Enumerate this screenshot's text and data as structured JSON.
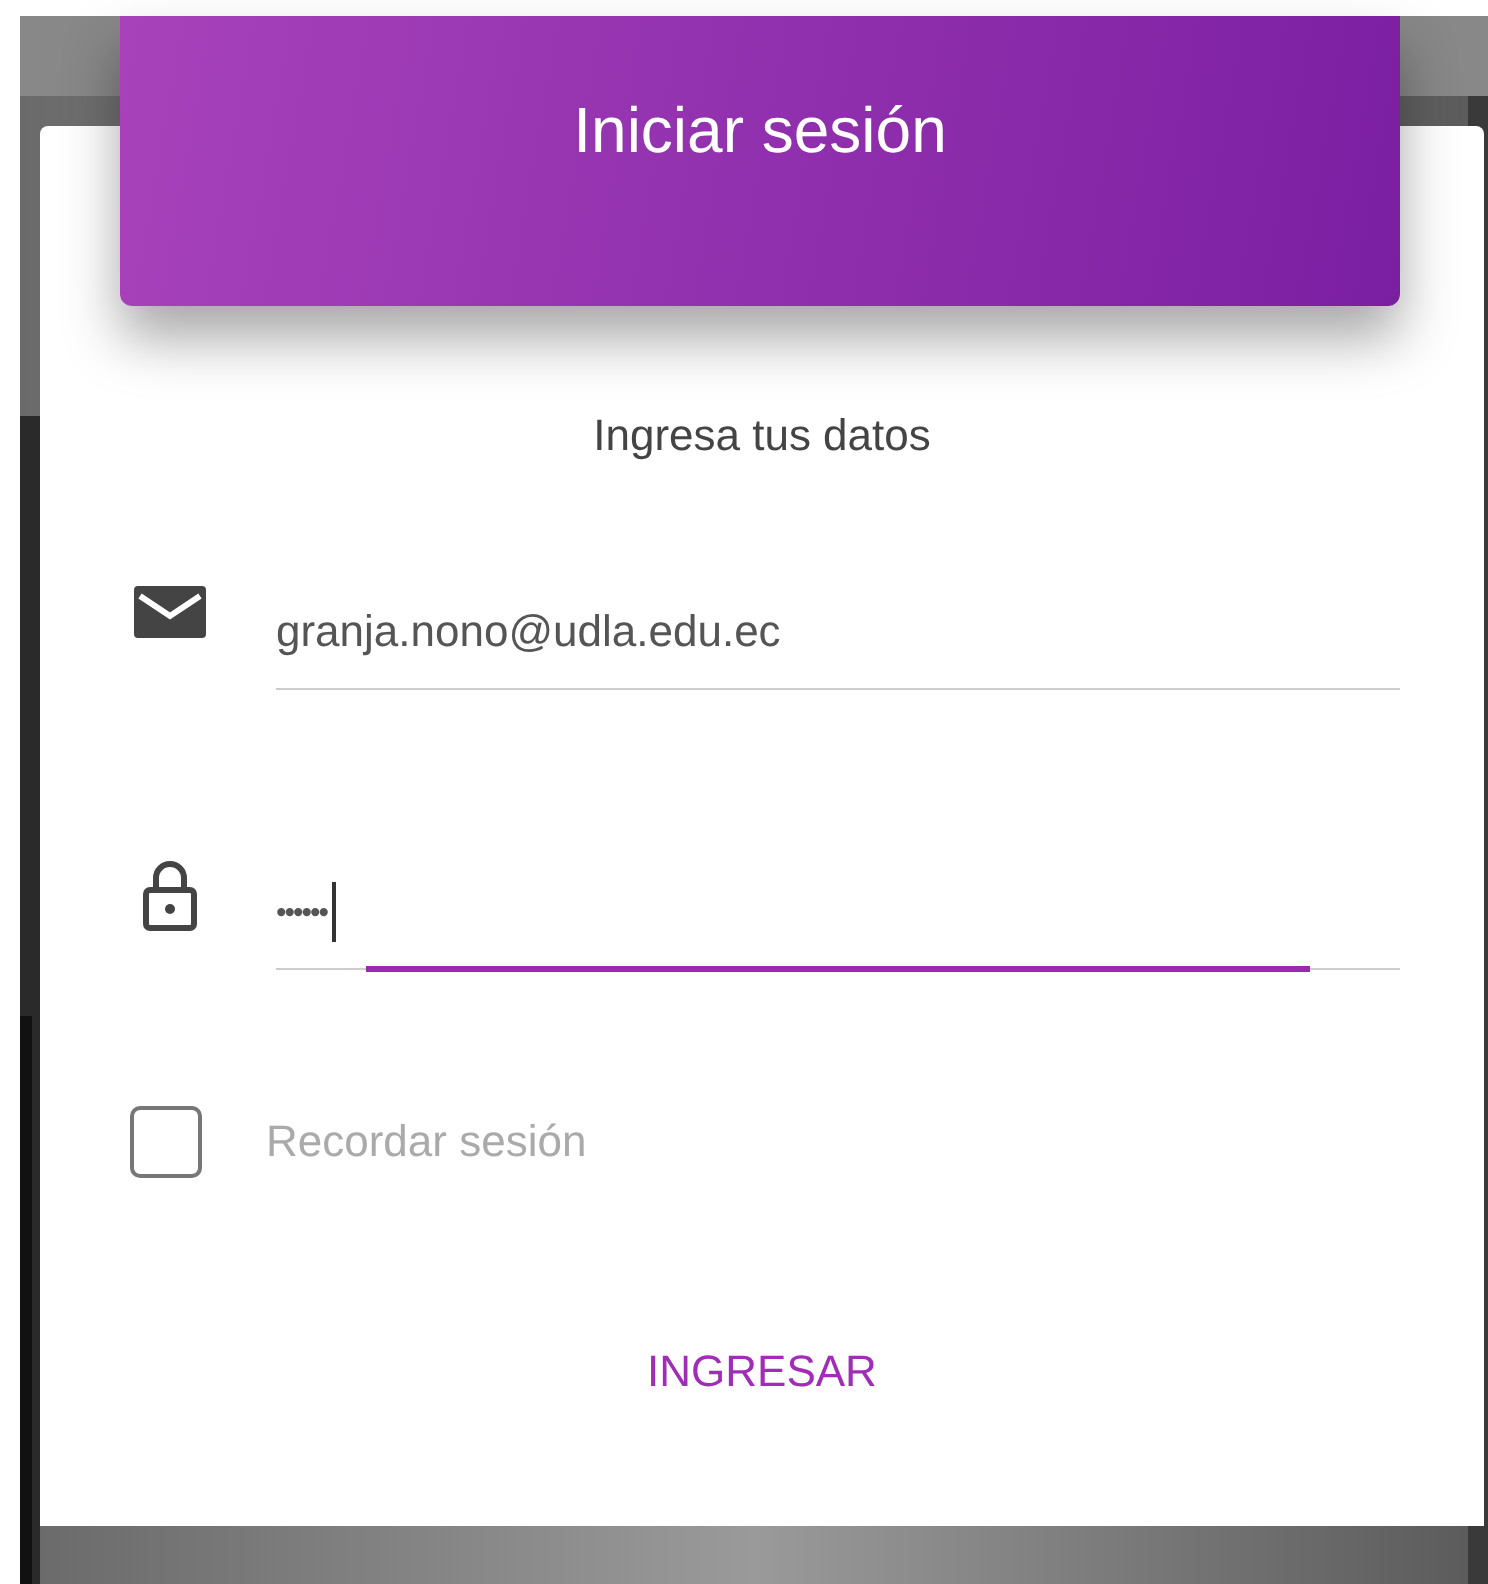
{
  "header": {
    "title": "Iniciar sesión"
  },
  "subtitle": "Ingresa tus datos",
  "fields": [
    {
      "kind": "email",
      "value": "granja.nono@udla.edu.ec",
      "focused": false
    },
    {
      "kind": "password",
      "value": "••••••",
      "focused": true
    }
  ],
  "remember": {
    "label": "Recordar sesión",
    "checked": false
  },
  "submit": {
    "label": "INGRESAR"
  }
}
